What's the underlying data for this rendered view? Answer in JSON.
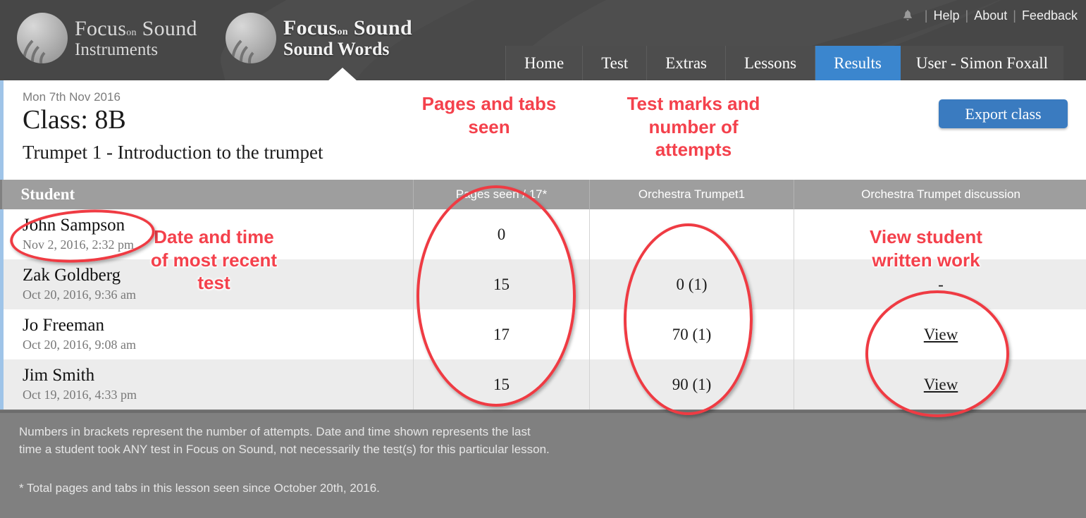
{
  "header": {
    "logo1": {
      "top": "Focus",
      "small": "on",
      "top2": "Sound",
      "bottom": "Instruments"
    },
    "logo2": {
      "top": "Focus",
      "small": "on",
      "top2": "Sound",
      "bottom": "Sound Words"
    },
    "bell_icon": "bell-icon",
    "utils": [
      {
        "label": "Help"
      },
      {
        "label": "About"
      },
      {
        "label": "Feedback"
      }
    ],
    "nav": [
      {
        "label": "Home",
        "active": false
      },
      {
        "label": "Test",
        "active": false
      },
      {
        "label": "Extras",
        "active": false
      },
      {
        "label": "Lessons",
        "active": false
      },
      {
        "label": "Results",
        "active": true
      },
      {
        "label": "User - Simon Foxall",
        "active": false
      }
    ],
    "active_tab_color": "#3b86ce"
  },
  "info": {
    "date": "Mon 7th Nov 2016",
    "class_title": "Class: 8B",
    "lesson_title": "Trumpet 1 - Introduction to the trumpet",
    "export_label": "Export class",
    "export_color": "#3a7bc0"
  },
  "table": {
    "columns": [
      "Student",
      "Pages seen / 17*",
      "Orchestra Trumpet1",
      "Orchestra Trumpet discussion"
    ],
    "rows": [
      {
        "name": "John Sampson",
        "date": "Nov 2, 2016, 2:32 pm",
        "pages_seen": "0",
        "test_mark": "",
        "discussion": ""
      },
      {
        "name": "Zak Goldberg",
        "date": "Oct 20, 2016, 9:36 am",
        "pages_seen": "15",
        "test_mark": "0 (1)",
        "discussion": "-"
      },
      {
        "name": "Jo Freeman",
        "date": "Oct 20, 2016, 9:08 am",
        "pages_seen": "17",
        "test_mark": "70 (1)",
        "discussion": "View"
      },
      {
        "name": "Jim Smith",
        "date": "Oct 19, 2016, 4:33 pm",
        "pages_seen": "15",
        "test_mark": "90 (1)",
        "discussion": "View"
      }
    ]
  },
  "footer": {
    "note1": "Numbers in brackets represent the number of attempts. Date and time shown represents the last time a student took ANY test in Focus on Sound, not necessarily the test(s) for this particular lesson.",
    "note2": "* Total pages and tabs in this lesson seen since October 20th, 2016."
  },
  "annotations": {
    "color": "#f4414c",
    "pages": "Pages and tabs seen",
    "marks": "Test marks and number of attempts",
    "date": "Date and time of most recent test",
    "view": "View student written work"
  }
}
